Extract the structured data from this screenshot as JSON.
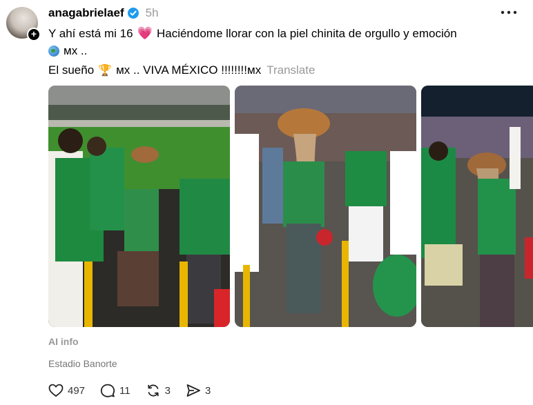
{
  "post": {
    "username": "anagabrielaef",
    "timestamp": "5h",
    "text": {
      "part1": "Y ahí está mi 16",
      "part2": "Haciéndome llorar con la piel chinita de orgullo y emoción",
      "part3": "ᴍx ..",
      "part4": "El sueño",
      "part5": "ᴍx .. VIVA MÉXICO !!!!!!!!ᴍx",
      "translate": "Translate"
    },
    "emojis": {
      "heart": "💗",
      "trophy": "🏆"
    },
    "images_count": 3
  },
  "info": {
    "ai_info": "AI info",
    "location": "Estadio Banorte"
  },
  "actions": {
    "likes": "497",
    "replies": "11",
    "reposts": "3",
    "shares": "3"
  },
  "icons": [
    "verified-icon",
    "more-icon",
    "heart-icon",
    "reply-icon",
    "repost-icon",
    "share-icon",
    "globe-icon",
    "trophy-icon"
  ],
  "colors": {
    "verified": "#1d9bf0",
    "secondary_text": "#999999",
    "heart_emoji": "#e4287d"
  }
}
